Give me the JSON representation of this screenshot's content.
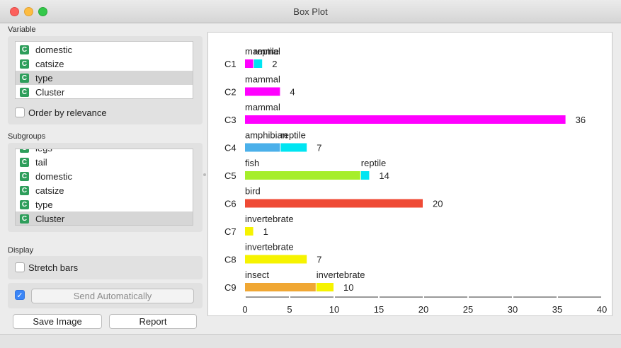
{
  "window": {
    "title": "Box Plot"
  },
  "variable": {
    "label": "Variable",
    "items": [
      {
        "label": "domestic",
        "icon": "C",
        "selected": false
      },
      {
        "label": "catsize",
        "icon": "C",
        "selected": false
      },
      {
        "label": "type",
        "icon": "C",
        "selected": true
      },
      {
        "label": "Cluster",
        "icon": "C",
        "selected": false
      }
    ],
    "order_by_relevance": {
      "label": "Order by relevance",
      "checked": false
    }
  },
  "subgroups": {
    "label": "Subgroups",
    "items": [
      {
        "label": "legs",
        "icon": "C",
        "selected": false
      },
      {
        "label": "tail",
        "icon": "C",
        "selected": false
      },
      {
        "label": "domestic",
        "icon": "C",
        "selected": false
      },
      {
        "label": "catsize",
        "icon": "C",
        "selected": false
      },
      {
        "label": "type",
        "icon": "C",
        "selected": false
      },
      {
        "label": "Cluster",
        "icon": "C",
        "selected": true
      }
    ]
  },
  "display": {
    "label": "Display",
    "stretch_bars": {
      "label": "Stretch bars",
      "checked": false
    }
  },
  "send": {
    "label": "Send Automatically",
    "checked": true
  },
  "buttons": {
    "save_image": "Save Image",
    "report": "Report"
  },
  "colors": {
    "mammal": "#ff00ff",
    "reptile": "#00e5f2",
    "amphibian": "#4bb0ea",
    "fish": "#a6ee2b",
    "bird": "#ef4a35",
    "invertebrate": "#f6f300",
    "insect": "#f0a733"
  },
  "chart_data": {
    "type": "bar",
    "orientation": "horizontal-stacked",
    "categories": [
      "C1",
      "C2",
      "C3",
      "C4",
      "C5",
      "C6",
      "C7",
      "C8",
      "C9"
    ],
    "rows": [
      {
        "cluster": "C1",
        "total": "2",
        "segments": [
          {
            "name": "mammal",
            "value": 1
          },
          {
            "name": "reptile",
            "value": 1
          }
        ]
      },
      {
        "cluster": "C2",
        "total": "4",
        "segments": [
          {
            "name": "mammal",
            "value": 4
          }
        ]
      },
      {
        "cluster": "C3",
        "total": "36",
        "segments": [
          {
            "name": "mammal",
            "value": 36
          }
        ]
      },
      {
        "cluster": "C4",
        "total": "7",
        "segments": [
          {
            "name": "amphibian",
            "value": 4
          },
          {
            "name": "reptile",
            "value": 3
          }
        ]
      },
      {
        "cluster": "C5",
        "total": "14",
        "segments": [
          {
            "name": "fish",
            "value": 13
          },
          {
            "name": "reptile",
            "value": 1
          }
        ]
      },
      {
        "cluster": "C6",
        "total": "20",
        "segments": [
          {
            "name": "bird",
            "value": 20
          }
        ]
      },
      {
        "cluster": "C7",
        "total": "1",
        "segments": [
          {
            "name": "invertebrate",
            "value": 1
          }
        ]
      },
      {
        "cluster": "C8",
        "total": "7",
        "segments": [
          {
            "name": "invertebrate",
            "value": 7
          }
        ]
      },
      {
        "cluster": "C9",
        "total": "10",
        "segments": [
          {
            "name": "insect",
            "value": 8
          },
          {
            "name": "invertebrate",
            "value": 2
          }
        ]
      }
    ],
    "xlim": [
      0,
      40
    ],
    "xticks": [
      "0",
      "5",
      "10",
      "15",
      "20",
      "25",
      "30",
      "35",
      "40"
    ],
    "grid": false
  }
}
